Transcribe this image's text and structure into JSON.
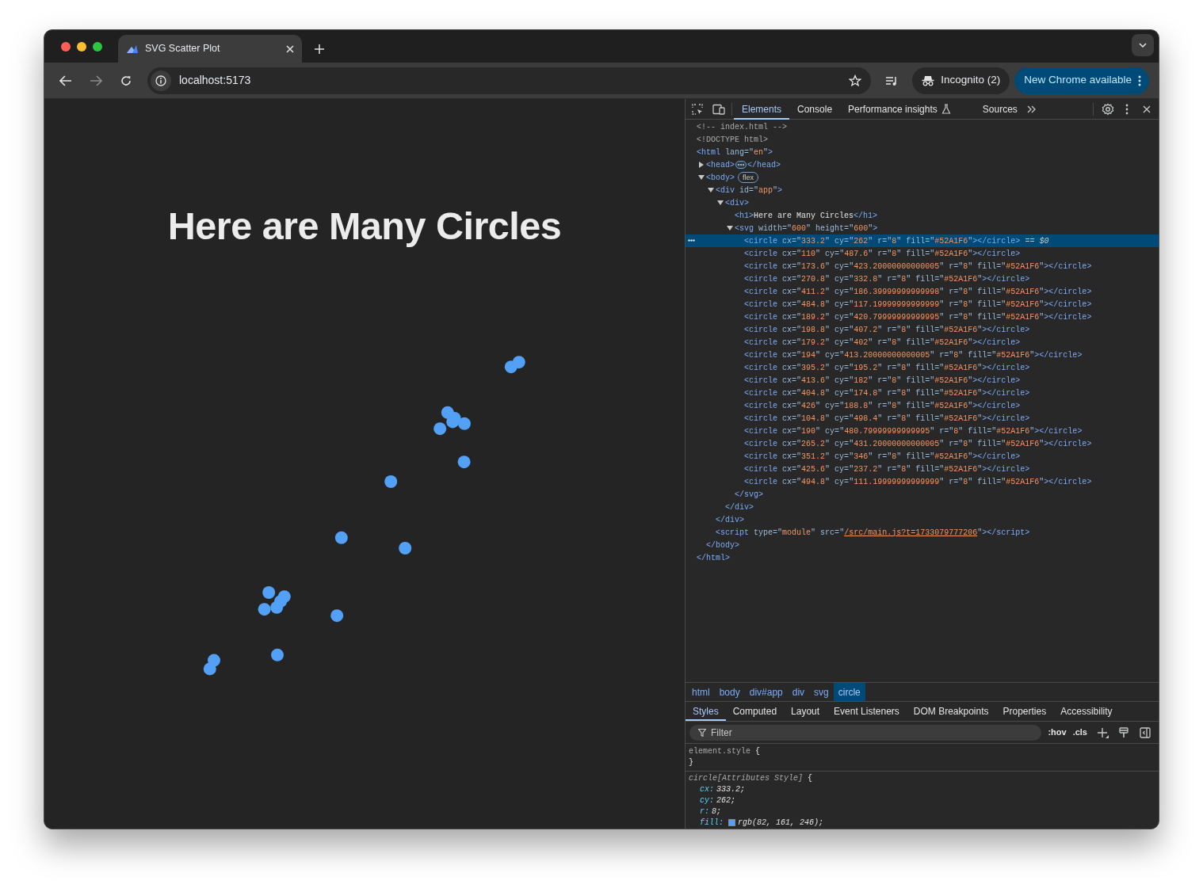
{
  "window": {
    "tab": {
      "title": "SVG Scatter Plot",
      "selected": true
    },
    "address": "localhost:5173",
    "profile": "Incognito (2)",
    "update_button": "New Chrome available"
  },
  "page": {
    "heading": "Here are Many Circles"
  },
  "devtools": {
    "tabs": [
      {
        "kind": "plain",
        "label": "Elements",
        "selected": true
      },
      {
        "kind": "plain",
        "label": "Console",
        "selected": false
      },
      {
        "kind": "experimental",
        "label": "Performance insights",
        "selected": false
      },
      {
        "kind": "plain",
        "label": "Sources",
        "selected": false
      }
    ],
    "dom_tree": [
      {
        "kind": "comment",
        "text": "<!-- index.html -->",
        "selected": false
      },
      {
        "kind": "doctype",
        "text": "<!DOCTYPE html>",
        "selected": false
      },
      {
        "kind": "element",
        "open": "<html lang=\"en\">",
        "close": "</html>",
        "selected": false,
        "children": [
          {
            "kind": "element",
            "open": "<head>",
            "close": "</head>",
            "expanded": false,
            "selected": false
          },
          {
            "kind": "element",
            "open": "<body>",
            "close": "</body>",
            "expanded": true,
            "badge": "flex",
            "selected": false,
            "children": [
              {
                "kind": "element",
                "open": "<div id=\"app\">",
                "close": "</div>",
                "expanded": true,
                "selected": false,
                "children": [
                  {
                    "kind": "element",
                    "open": "<div>",
                    "close": "</div>",
                    "expanded": true,
                    "selected": false,
                    "children": [
                      {
                        "kind": "leaf",
                        "text": "<h1>Here are Many Circles</h1>",
                        "selected": false
                      },
                      {
                        "kind": "element",
                        "open": "<svg width=\"600\" height=\"600\">",
                        "close": "</svg>",
                        "expanded": true,
                        "selected": false,
                        "children": [
                          {
                            "kind": "leaf",
                            "text": "<circle cx=\"333.2\" cy=\"262\" r=\"8\" fill=\"#52A1F6\"></circle>",
                            "selected": true,
                            "reference": "== $0"
                          },
                          {
                            "kind": "leaf",
                            "text": "<circle cx=\"110\" cy=\"487.6\" r=\"8\" fill=\"#52A1F6\"></circle>",
                            "selected": false
                          },
                          {
                            "kind": "leaf",
                            "text": "<circle cx=\"173.6\" cy=\"423.20000000000005\" r=\"8\" fill=\"#52A1F6\"></circle>",
                            "selected": false
                          },
                          {
                            "kind": "leaf",
                            "text": "<circle cx=\"270.8\" cy=\"332.8\" r=\"8\" fill=\"#52A1F6\"></circle>",
                            "selected": false
                          },
                          {
                            "kind": "leaf",
                            "text": "<circle cx=\"411.2\" cy=\"186.39999999999998\" r=\"8\" fill=\"#52A1F6\"></circle>",
                            "selected": false
                          },
                          {
                            "kind": "leaf",
                            "text": "<circle cx=\"484.8\" cy=\"117.19999999999999\" r=\"8\" fill=\"#52A1F6\"></circle>",
                            "selected": false
                          },
                          {
                            "kind": "leaf",
                            "text": "<circle cx=\"189.2\" cy=\"420.79999999999995\" r=\"8\" fill=\"#52A1F6\"></circle>",
                            "selected": false
                          },
                          {
                            "kind": "leaf",
                            "text": "<circle cx=\"198.8\" cy=\"407.2\" r=\"8\" fill=\"#52A1F6\"></circle>",
                            "selected": false
                          },
                          {
                            "kind": "leaf",
                            "text": "<circle cx=\"179.2\" cy=\"402\" r=\"8\" fill=\"#52A1F6\"></circle>",
                            "selected": false
                          },
                          {
                            "kind": "leaf",
                            "text": "<circle cx=\"194\" cy=\"413.20000000000005\" r=\"8\" fill=\"#52A1F6\"></circle>",
                            "selected": false
                          },
                          {
                            "kind": "leaf",
                            "text": "<circle cx=\"395.2\" cy=\"195.2\" r=\"8\" fill=\"#52A1F6\"></circle>",
                            "selected": false
                          },
                          {
                            "kind": "leaf",
                            "text": "<circle cx=\"413.6\" cy=\"182\" r=\"8\" fill=\"#52A1F6\"></circle>",
                            "selected": false
                          },
                          {
                            "kind": "leaf",
                            "text": "<circle cx=\"404.8\" cy=\"174.8\" r=\"8\" fill=\"#52A1F6\"></circle>",
                            "selected": false
                          },
                          {
                            "kind": "leaf",
                            "text": "<circle cx=\"426\" cy=\"188.8\" r=\"8\" fill=\"#52A1F6\"></circle>",
                            "selected": false
                          },
                          {
                            "kind": "leaf",
                            "text": "<circle cx=\"104.8\" cy=\"498.4\" r=\"8\" fill=\"#52A1F6\"></circle>",
                            "selected": false
                          },
                          {
                            "kind": "leaf",
                            "text": "<circle cx=\"190\" cy=\"480.79999999999995\" r=\"8\" fill=\"#52A1F6\"></circle>",
                            "selected": false
                          },
                          {
                            "kind": "leaf",
                            "text": "<circle cx=\"265.2\" cy=\"431.20000000000005\" r=\"8\" fill=\"#52A1F6\"></circle>",
                            "selected": false
                          },
                          {
                            "kind": "leaf",
                            "text": "<circle cx=\"351.2\" cy=\"346\" r=\"8\" fill=\"#52A1F6\"></circle>",
                            "selected": false
                          },
                          {
                            "kind": "leaf",
                            "text": "<circle cx=\"425.6\" cy=\"237.2\" r=\"8\" fill=\"#52A1F6\"></circle>",
                            "selected": false
                          },
                          {
                            "kind": "leaf",
                            "text": "<circle cx=\"494.8\" cy=\"111.19999999999999\" r=\"8\" fill=\"#52A1F6\"></circle>",
                            "selected": false
                          }
                        ]
                      }
                    ]
                  }
                ]
              },
              {
                "kind": "script",
                "before": "<script type=\"module\" src=\"",
                "link": "/src/main.js?t=1733079777206",
                "after": "\"></script>",
                "selected": false
              }
            ]
          }
        ]
      }
    ],
    "breadcrumbs": [
      {
        "label": "html",
        "selected": false
      },
      {
        "label": "body",
        "selected": false
      },
      {
        "label": "div#app",
        "selected": false
      },
      {
        "label": "div",
        "selected": false
      },
      {
        "label": "svg",
        "selected": false
      },
      {
        "label": "circle",
        "selected": true
      }
    ],
    "style_tabs": [
      {
        "label": "Styles",
        "selected": true
      },
      {
        "label": "Computed",
        "selected": false
      },
      {
        "label": "Layout",
        "selected": false
      },
      {
        "label": "Event Listeners",
        "selected": false
      },
      {
        "label": "DOM Breakpoints",
        "selected": false
      },
      {
        "label": "Properties",
        "selected": false
      },
      {
        "label": "Accessibility",
        "selected": false
      }
    ],
    "filter": {
      "placeholder": "Filter"
    },
    "filter_buttons": [
      ":hov",
      ".cls"
    ],
    "rules": [
      {
        "selector": "element.style",
        "open": "{",
        "close": "}",
        "italic": false
      },
      {
        "selector": "circle[Attributes Style]",
        "open": "{",
        "italic": true,
        "props": [
          {
            "name": "cx:",
            "value": "333.2;"
          },
          {
            "name": "cy:",
            "value": "262;"
          },
          {
            "name": "r:",
            "value": "8;"
          },
          {
            "name": "fill:",
            "value": "rgb(82, 161, 246);",
            "swatch": true
          }
        ]
      }
    ]
  }
}
